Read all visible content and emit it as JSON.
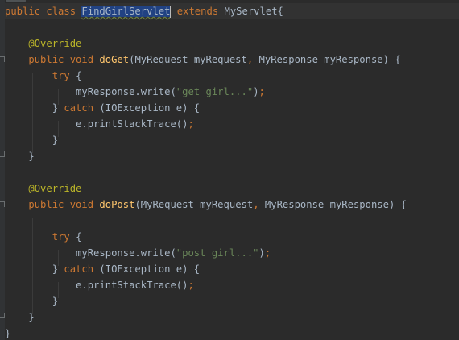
{
  "code_lines": [
    [
      {
        "t": "kw",
        "v": "public class "
      },
      {
        "t": "cls-ref",
        "v": "FindGirlServlet"
      },
      {
        "t": "caret",
        "v": ""
      },
      {
        "t": "plain",
        "v": " "
      },
      {
        "t": "kw",
        "v": "extends "
      },
      {
        "t": "plain",
        "v": "MyServlet{"
      }
    ],
    [],
    [
      {
        "t": "plain",
        "v": "    "
      },
      {
        "t": "ann",
        "v": "@Override"
      }
    ],
    [
      {
        "t": "plain",
        "v": "    "
      },
      {
        "t": "kw",
        "v": "public void "
      },
      {
        "t": "fn",
        "v": "doGet"
      },
      {
        "t": "plain",
        "v": "(MyRequest myRequest"
      },
      {
        "t": "kw",
        "v": ", "
      },
      {
        "t": "plain",
        "v": "MyResponse myResponse) {"
      }
    ],
    [
      {
        "t": "plain",
        "v": "        "
      },
      {
        "t": "kw",
        "v": "try "
      },
      {
        "t": "plain",
        "v": "{"
      }
    ],
    [
      {
        "t": "plain",
        "v": "            myResponse.write("
      },
      {
        "t": "str",
        "v": "\"get girl...\""
      },
      {
        "t": "plain",
        "v": ")"
      },
      {
        "t": "kw",
        "v": ";"
      }
    ],
    [
      {
        "t": "plain",
        "v": "        } "
      },
      {
        "t": "kw",
        "v": "catch "
      },
      {
        "t": "plain",
        "v": "(IOException e) {"
      }
    ],
    [
      {
        "t": "plain",
        "v": "            e.printStackTrace()"
      },
      {
        "t": "kw",
        "v": ";"
      }
    ],
    [
      {
        "t": "plain",
        "v": "        }"
      }
    ],
    [
      {
        "t": "plain",
        "v": "    }"
      }
    ],
    [],
    [
      {
        "t": "plain",
        "v": "    "
      },
      {
        "t": "ann",
        "v": "@Override"
      }
    ],
    [
      {
        "t": "plain",
        "v": "    "
      },
      {
        "t": "kw",
        "v": "public void "
      },
      {
        "t": "fn",
        "v": "doPost"
      },
      {
        "t": "plain",
        "v": "(MyRequest myRequest"
      },
      {
        "t": "kw",
        "v": ", "
      },
      {
        "t": "plain",
        "v": "MyResponse myResponse) {"
      }
    ],
    [],
    [
      {
        "t": "plain",
        "v": "        "
      },
      {
        "t": "kw",
        "v": "try "
      },
      {
        "t": "plain",
        "v": "{"
      }
    ],
    [
      {
        "t": "plain",
        "v": "            myResponse.write("
      },
      {
        "t": "str",
        "v": "\"post girl...\""
      },
      {
        "t": "plain",
        "v": ")"
      },
      {
        "t": "kw",
        "v": ";"
      }
    ],
    [
      {
        "t": "plain",
        "v": "        } "
      },
      {
        "t": "kw",
        "v": "catch "
      },
      {
        "t": "plain",
        "v": "(IOException e) {"
      }
    ],
    [
      {
        "t": "plain",
        "v": "            e.printStackTrace()"
      },
      {
        "t": "kw",
        "v": ";"
      }
    ],
    [
      {
        "t": "plain",
        "v": "        }"
      }
    ],
    [
      {
        "t": "plain",
        "v": "    }"
      }
    ],
    [
      {
        "t": "plain",
        "v": "}"
      }
    ]
  ],
  "colors": {
    "background": "#2b2b2b",
    "keyword": "#cc7832",
    "annotation": "#bbb529",
    "method": "#ffc66d",
    "string": "#6a8759",
    "text": "#a9b7c6",
    "selection": "#214283"
  },
  "icons": [
    "fold-icon"
  ]
}
